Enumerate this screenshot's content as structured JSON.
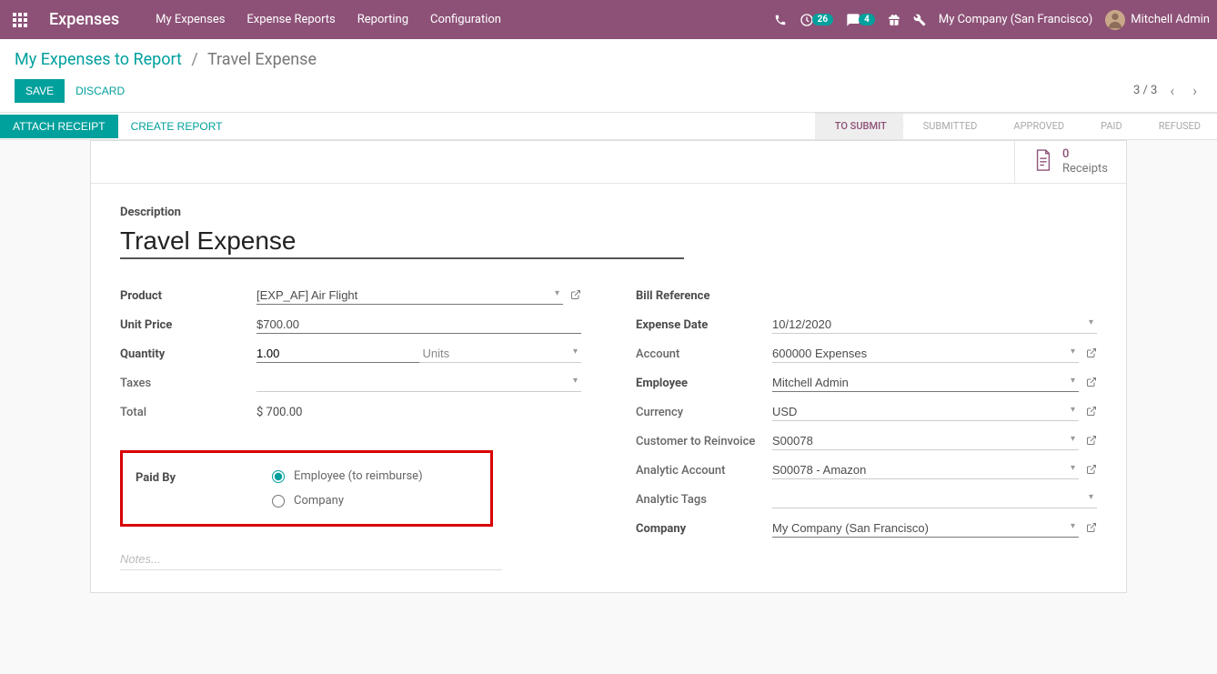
{
  "topnav": {
    "app_title": "Expenses",
    "menu": [
      "My Expenses",
      "Expense Reports",
      "Reporting",
      "Configuration"
    ],
    "activity_badge": "26",
    "chat_badge": "4",
    "company": "My Company (San Francisco)",
    "user": "Mitchell Admin"
  },
  "breadcrumb": {
    "parent": "My Expenses to Report",
    "current": "Travel Expense"
  },
  "actions": {
    "save": "SAVE",
    "discard": "DISCARD",
    "attach": "ATTACH RECEIPT",
    "create_report": "CREATE REPORT"
  },
  "pager": {
    "text": "3 / 3"
  },
  "status": [
    "TO SUBMIT",
    "SUBMITTED",
    "APPROVED",
    "PAID",
    "REFUSED"
  ],
  "receipts": {
    "count": "0",
    "label": "Receipts"
  },
  "form": {
    "description_label": "Description",
    "description": "Travel Expense",
    "left": {
      "product_label": "Product",
      "product": "[EXP_AF] Air Flight",
      "unit_price_label": "Unit Price",
      "unit_price": "$700.00",
      "quantity_label": "Quantity",
      "quantity": "1.00",
      "quantity_unit": "Units",
      "taxes_label": "Taxes",
      "taxes": "",
      "total_label": "Total",
      "total": "$ 700.00"
    },
    "right": {
      "bill_ref_label": "Bill Reference",
      "bill_ref": "",
      "expense_date_label": "Expense Date",
      "expense_date": "10/12/2020",
      "account_label": "Account",
      "account": "600000 Expenses",
      "employee_label": "Employee",
      "employee": "Mitchell Admin",
      "currency_label": "Currency",
      "currency": "USD",
      "customer_label": "Customer to Reinvoice",
      "customer": "S00078",
      "analytic_account_label": "Analytic Account",
      "analytic_account": "S00078 - Amazon",
      "analytic_tags_label": "Analytic Tags",
      "analytic_tags": "",
      "company_label": "Company",
      "company": "My Company (San Francisco)"
    },
    "paid_by_label": "Paid By",
    "paid_by_options": {
      "employee": "Employee (to reimburse)",
      "company": "Company"
    },
    "notes_placeholder": "Notes..."
  }
}
